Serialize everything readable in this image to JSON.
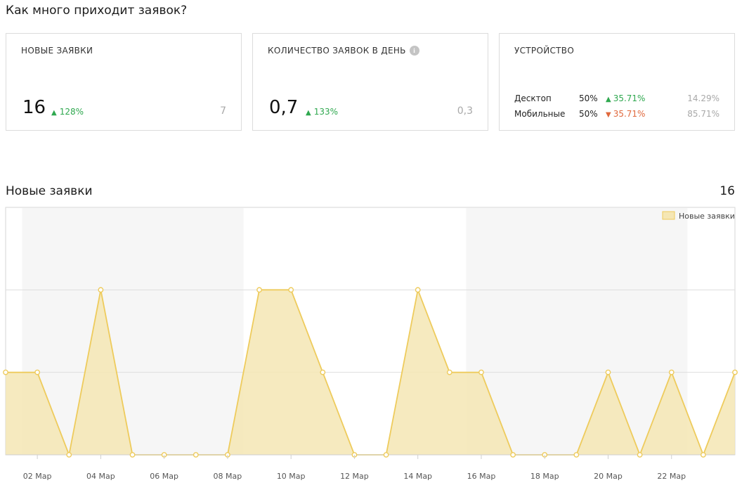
{
  "page": {
    "title": "Как много приходит заявок?"
  },
  "cards": {
    "new_requests": {
      "label": "НОВЫЕ ЗАЯВКИ",
      "value": "16",
      "trend": "128%",
      "trend_direction": "up",
      "previous": "7"
    },
    "per_day": {
      "label": "КОЛИЧЕСТВО ЗАЯВОК В ДЕНЬ",
      "info_icon": "info-icon",
      "value": "0,7",
      "trend": "133%",
      "trend_direction": "up",
      "previous": "0,3"
    },
    "devices": {
      "label": "УСТРОЙСТВО",
      "rows": [
        {
          "name": "Десктоп",
          "share": "50%",
          "trend": "35.71%",
          "direction": "up",
          "previous": "14.29%"
        },
        {
          "name": "Мобильные",
          "share": "50%",
          "trend": "35.71%",
          "direction": "down",
          "previous": "85.71%"
        }
      ]
    }
  },
  "section": {
    "title": "Новые заявки",
    "total": "16"
  },
  "colors": {
    "accent_fill": "#f5e6b4",
    "accent_line": "#eecb5c",
    "up": "#2fa84f",
    "down": "#e0683c",
    "muted": "#a8a8a8"
  },
  "chart_data": {
    "type": "area",
    "title": "",
    "legend": {
      "position": "top-right",
      "entries": [
        "Новые заявки"
      ]
    },
    "x": [
      "01 Мар",
      "02 Мар",
      "03 Мар",
      "04 Мар",
      "05 Мар",
      "06 Мар",
      "07 Мар",
      "08 Мар",
      "09 Мар",
      "10 Мар",
      "11 Мар",
      "12 Мар",
      "13 Мар",
      "14 Мар",
      "15 Мар",
      "16 Мар",
      "17 Мар",
      "18 Мар",
      "19 Мар",
      "20 Мар",
      "21 Мар",
      "22 Мар",
      "23 Мар",
      "24 Мар"
    ],
    "x_tick_labels": [
      "02 Мар",
      "04 Мар",
      "06 Мар",
      "08 Мар",
      "10 Мар",
      "12 Мар",
      "14 Мар",
      "16 Мар",
      "18 Мар",
      "20 Мар",
      "22 Мар"
    ],
    "series": [
      {
        "name": "Новые заявки",
        "values": [
          1,
          1,
          0,
          2,
          0,
          0,
          0,
          0,
          2,
          2,
          1,
          0,
          0,
          2,
          1,
          1,
          0,
          0,
          0,
          1,
          0,
          1,
          0,
          1
        ]
      }
    ],
    "ylim": [
      0,
      3
    ],
    "grid": true,
    "xlabel": "",
    "ylabel": ""
  }
}
